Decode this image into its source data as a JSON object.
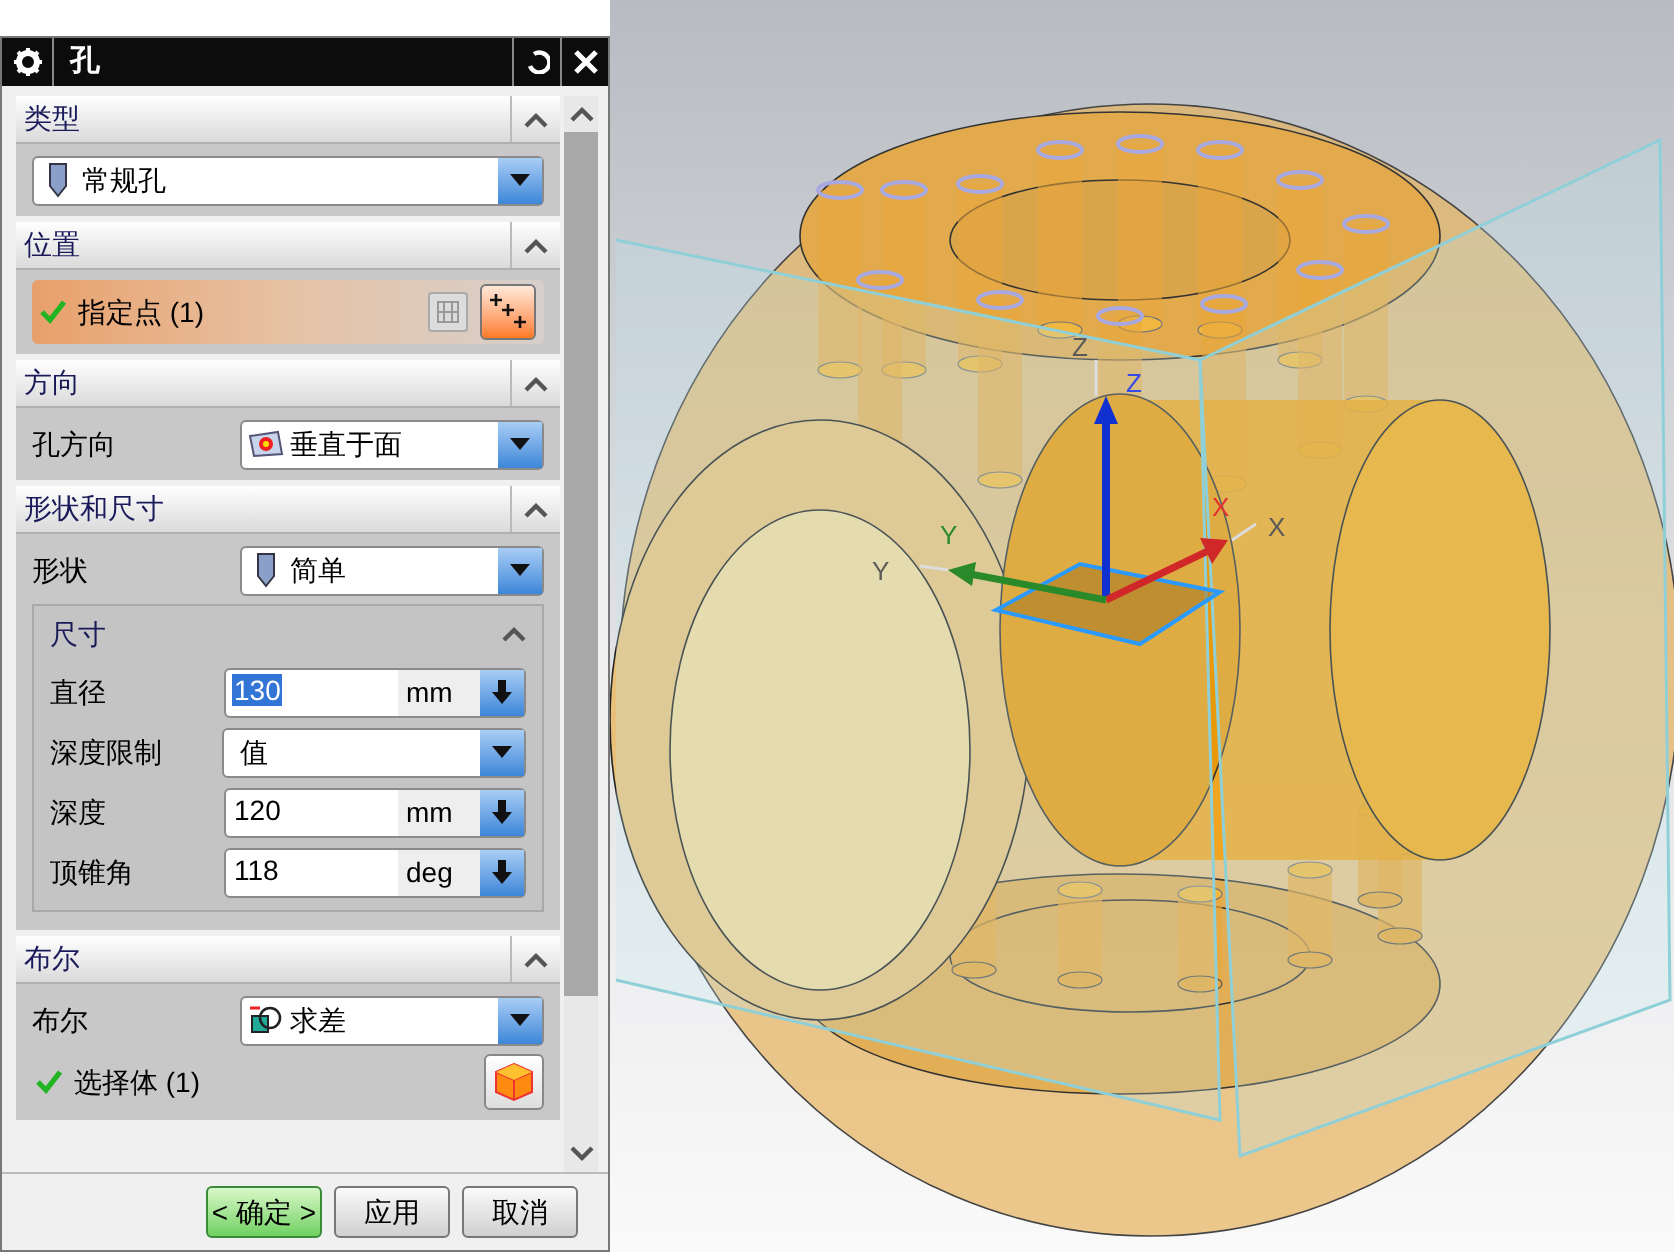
{
  "dialog": {
    "title": "孔",
    "sections": [
      {
        "title": "类型",
        "expanded": true,
        "rows": [
          {
            "kind": "dropdown",
            "value": "常规孔"
          }
        ]
      },
      {
        "title": "位置",
        "expanded": true,
        "rows": [
          {
            "kind": "point_select",
            "label": "指定点 (1)",
            "complete": true
          }
        ]
      },
      {
        "title": "方向",
        "expanded": true,
        "rows": [
          {
            "kind": "dropdown",
            "label": "孔方向",
            "value": "垂直于面"
          }
        ]
      },
      {
        "title": "形状和尺寸",
        "expanded": true,
        "rows": [
          {
            "kind": "dropdown",
            "label": "形状",
            "value": "简单"
          },
          {
            "kind": "group",
            "title": "尺寸",
            "expanded": true,
            "rows": [
              {
                "kind": "unit_field",
                "label": "直径",
                "value": "130",
                "unit": "mm",
                "selected": true
              },
              {
                "kind": "dropdown",
                "label": "深度限制",
                "value": "值"
              },
              {
                "kind": "unit_field",
                "label": "深度",
                "value": "120",
                "unit": "mm",
                "selected": false
              },
              {
                "kind": "unit_field",
                "label": "顶锥角",
                "value": "118",
                "unit": "deg",
                "selected": false
              }
            ]
          }
        ]
      },
      {
        "title": "布尔",
        "expanded": true,
        "rows": [
          {
            "kind": "dropdown",
            "label": "布尔",
            "value": "求差"
          },
          {
            "kind": "body_select",
            "label": "选择体 (1)",
            "complete": true
          }
        ]
      }
    ],
    "buttons": [
      {
        "label": "< 确定 >",
        "default": true
      },
      {
        "label": "应用",
        "default": false
      },
      {
        "label": "取消",
        "default": false
      }
    ]
  },
  "viewport": {
    "axis_labels": [
      {
        "label": "Z"
      },
      {
        "label": "Z"
      },
      {
        "label": "Y"
      },
      {
        "label": "Y"
      },
      {
        "label": "X"
      },
      {
        "label": "X"
      }
    ]
  }
}
